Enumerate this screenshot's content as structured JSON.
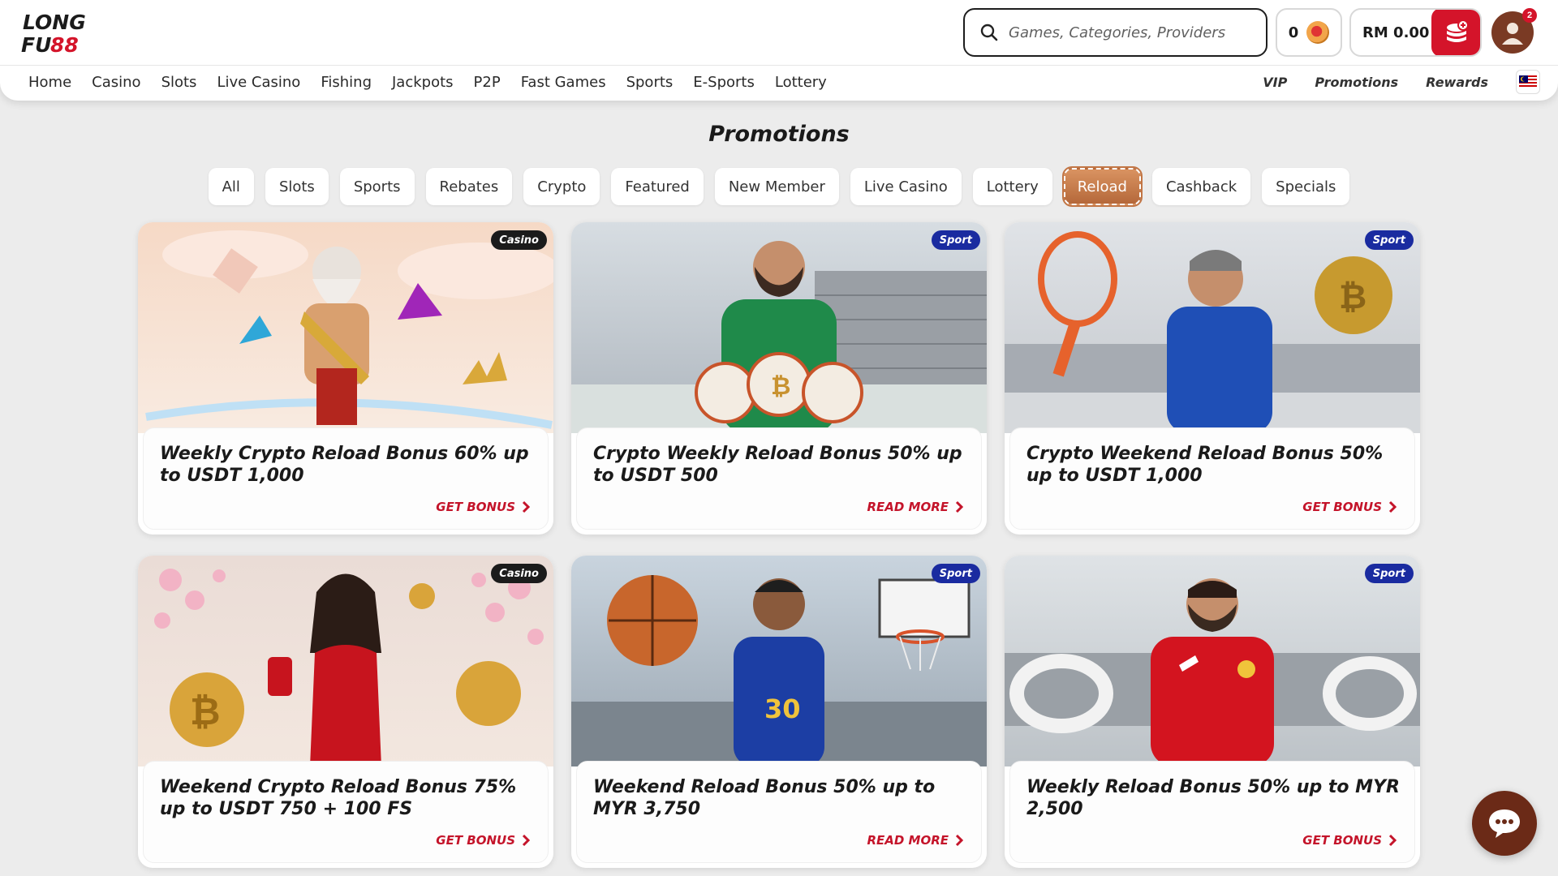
{
  "brand": {
    "line1": "LONG",
    "line2_a": "FU",
    "line2_b": "88"
  },
  "search": {
    "placeholder": "Games, Categories, Providers"
  },
  "wallet": {
    "coins": "0",
    "balance": "RM 0.00"
  },
  "notifications": {
    "count": "2"
  },
  "nav": {
    "items": [
      "Home",
      "Casino",
      "Slots",
      "Live Casino",
      "Fishing",
      "Jackpots",
      "P2P",
      "Fast Games",
      "Sports",
      "E-Sports",
      "Lottery"
    ],
    "right": [
      "VIP",
      "Promotions",
      "Rewards"
    ]
  },
  "page": {
    "title": "Promotions"
  },
  "filters": {
    "items": [
      "All",
      "Slots",
      "Sports",
      "Rebates",
      "Crypto",
      "Featured",
      "New Member",
      "Live Casino",
      "Lottery",
      "Reload",
      "Cashback",
      "Specials"
    ],
    "active": "Reload"
  },
  "promos": [
    {
      "tag": "Casino",
      "title": "Weekly Crypto Reload Bonus 60% up to USDT 1,000",
      "cta": "GET BONUS"
    },
    {
      "tag": "Sport",
      "title": "Crypto Weekly Reload Bonus 50% up to USDT 500",
      "cta": "READ MORE"
    },
    {
      "tag": "Sport",
      "title": "Crypto Weekend Reload Bonus 50% up to USDT 1,000",
      "cta": "GET BONUS"
    },
    {
      "tag": "Casino",
      "title": "Weekend Crypto Reload Bonus 75% up to USDT 750 + 100 FS",
      "cta": "GET BONUS"
    },
    {
      "tag": "Sport",
      "title": "Weekend Reload Bonus 50% up to MYR 3,750",
      "cta": "READ MORE"
    },
    {
      "tag": "Sport",
      "title": "Weekly Reload Bonus 50% up to MYR 2,500",
      "cta": "GET BONUS"
    }
  ],
  "colors": {
    "accent": "#c4142a",
    "active_chip": "#c27544",
    "casino_tag": "#1b1b1b",
    "sport_tag": "#1a2ba0"
  }
}
